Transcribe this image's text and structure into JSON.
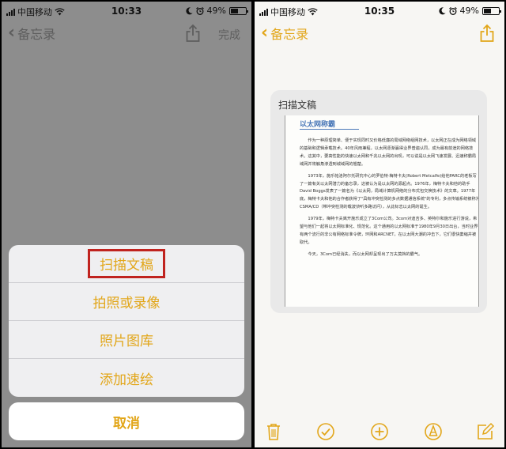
{
  "left": {
    "status": {
      "carrier": "中国移动",
      "time": "10:33",
      "battery": "49%",
      "battery_level": 0.49
    },
    "nav": {
      "back_label": "备忘录",
      "done_label": "完成"
    },
    "sheet": {
      "items": [
        {
          "label": "扫描文稿"
        },
        {
          "label": "拍照或录像"
        },
        {
          "label": "照片图库"
        },
        {
          "label": "添加速绘"
        }
      ],
      "cancel_label": "取消"
    }
  },
  "right": {
    "status": {
      "carrier": "中国移动",
      "time": "10:35",
      "battery": "49%",
      "battery_level": 0.49
    },
    "nav": {
      "back_label": "备忘录"
    },
    "card": {
      "title": "扫描文稿",
      "doc_heading": "以太网称霸",
      "paragraphs": [
        "作为一种原理简单、便于实现同时又价格低廉的局域网络组网技术，以太网正在成为网络领域的基础和逻辑承载技术。40年风雨兼程，以太网逐渐赢得业界普遍认同，成为最有前途的网络技术。这其中，要高性能的快速以太网和千兆以太网的出现，可以说是以太网飞速发展、迅速称霸局域网并将触角渗透到城域网的翘楚。",
        "1973年，施乐帕洛阿尔托研究中心的罗伯特·梅特卡夫(Robert Metcalfe)给他PARC的老板写了一篇有关以太网潜力的备忘录，这被认为是以太网的源起点。1976年，梅特卡夫和他的助手David Boggs发表了一篇名为《以太网，局域计算机网络的分布式包交换技术》的文章。1977年底，梅特卡夫和他的合作者获得了\"具有冲突检测的多点数据通信系统\"的专利，多点传输系统被称为CSMA/CD（带冲突检测的载波侦听多路访问），从此标志以太网的诞生。",
        "1979年，梅特卡夫离开施乐成立了3Com公司。3com对迪吉多、英特尔和施乐进行游说，希望与他们一起将以太网标准化、规范化。这个通用的以太网标准于1980年9月30日出台，当时业界有两个流行的非公有网络标准令牌，环网和ARCNET，在以太网大潮的冲击下，它们很快萎缩并被取代。",
        "今天，3Com已经消失，而以太网却呈现出了万夫莫挡的霸气。"
      ]
    },
    "toolbar": {
      "icons": [
        "trash-icon",
        "checkmark-circle-icon",
        "plus-circle-icon",
        "pen-circle-icon",
        "compose-icon"
      ]
    }
  },
  "colors": {
    "accent": "#e2a619",
    "highlight": "#c0231f",
    "dim_overlay": "#8d8d8d"
  }
}
